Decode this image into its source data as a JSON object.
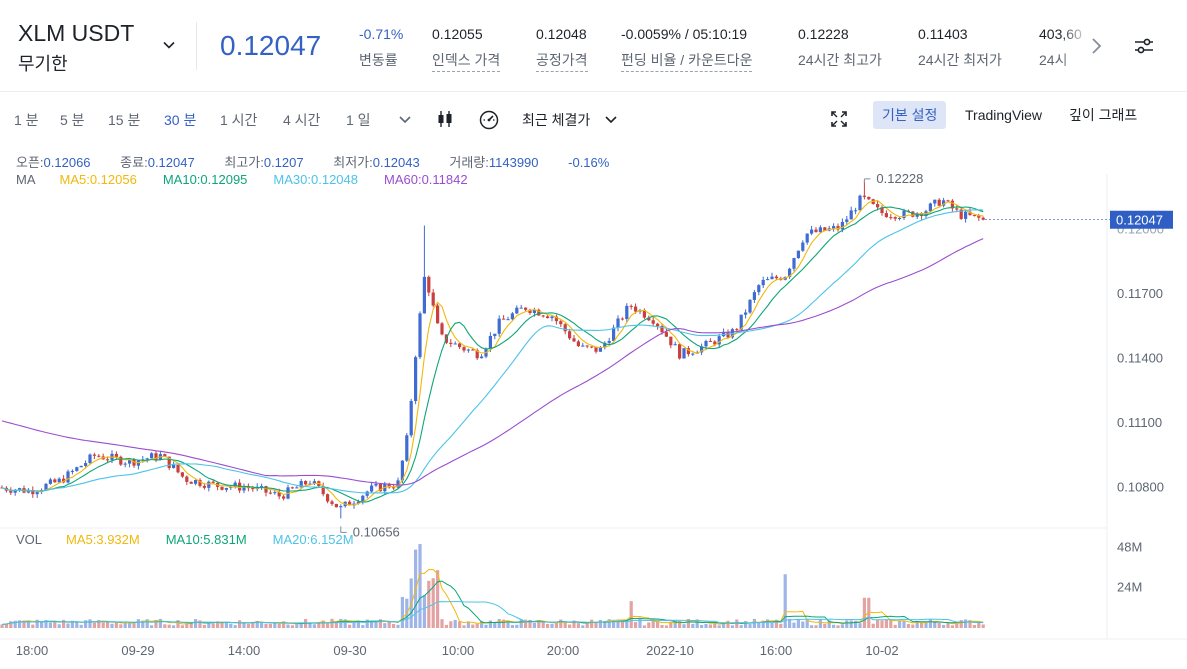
{
  "header": {
    "symbol": "XLM USDT",
    "contract_type": "무기한",
    "last_price": "0.12047",
    "stats": [
      {
        "value": "-0.71%",
        "label": "변동률",
        "negative": true,
        "dotted": false
      },
      {
        "value": "0.12055",
        "label": "인덱스 가격",
        "negative": false,
        "dotted": true
      },
      {
        "value": "0.12048",
        "label": "공정가격",
        "negative": false,
        "dotted": true
      },
      {
        "value": "-0.0059% / 05:10:19",
        "label": "펀딩 비율 / 카운트다운",
        "negative": false,
        "dotted": true
      },
      {
        "value": "0.12228",
        "label": "24시간 최고가",
        "negative": false,
        "dotted": false
      },
      {
        "value": "0.11403",
        "label": "24시간 최저가",
        "negative": false,
        "dotted": false
      },
      {
        "value": "403,60",
        "label": "24시",
        "negative": false,
        "dotted": false
      }
    ]
  },
  "toolbar": {
    "intervals": [
      "1 분",
      "5 분",
      "15 분",
      "30 분",
      "1 시간",
      "4 시간",
      "1 일"
    ],
    "active_interval": "30 분",
    "price_type": "최근 체결가",
    "views": [
      "기본 설정",
      "TradingView",
      "깊이 그래프"
    ],
    "active_view": "기본 설정",
    "icons": [
      "chevron-down-icon",
      "candlestick-icon",
      "gauge-icon",
      "fullscreen-icon"
    ]
  },
  "ohlc_legend": {
    "open_label": "오픈:",
    "open": "0.12066",
    "close_label": "종료:",
    "close": "0.12047",
    "high_label": "최고가:",
    "high": "0.1207",
    "low_label": "최저가:",
    "low": "0.12043",
    "volume_label": "거래량:",
    "volume": "1143990",
    "change": "-0.16%"
  },
  "ma_legend": {
    "label": "MA",
    "items": [
      {
        "text": "MA5:0.12056",
        "color": "#f0b90b"
      },
      {
        "text": "MA10:0.12095",
        "color": "#0ca678"
      },
      {
        "text": "MA30:0.12048",
        "color": "#4cc3e8"
      },
      {
        "text": "MA60:0.11842",
        "color": "#9b4dcf"
      }
    ]
  },
  "vol_legend": {
    "label": "VOL",
    "items": [
      {
        "text": "MA5:3.932M",
        "color": "#f0b90b"
      },
      {
        "text": "MA10:5.831M",
        "color": "#0ca678"
      },
      {
        "text": "MA20:6.152M",
        "color": "#4cc3e8"
      }
    ]
  },
  "colors": {
    "up": "#3f6bd3",
    "down": "#c9403f",
    "price_tag": "#2f5fc4",
    "axis_text": "#5e6673"
  },
  "chart_data": {
    "type": "candlestick",
    "price_axis_ticks": [
      "0.11700",
      "0.11400",
      "0.11100",
      "0.10800"
    ],
    "volume_axis_ticks": [
      "48M",
      "24M"
    ],
    "time_axis_labels": [
      "18:00",
      "09-29",
      "14:00",
      "09-30",
      "10:00",
      "20:00",
      "2022-10",
      "16:00",
      "10-02"
    ],
    "high_marker": "0.12228",
    "low_marker": "0.10656",
    "current_price": "0.12047",
    "current_price_behind": "0.12000",
    "ylim": [
      0.1063,
      0.1226
    ],
    "volume_max": 53
  }
}
